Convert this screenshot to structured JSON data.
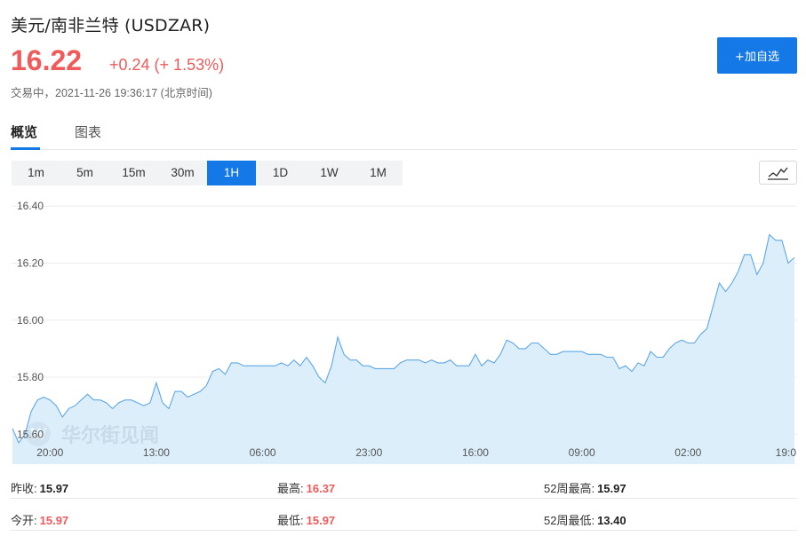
{
  "header": {
    "title": "美元/南非兰特 (USDZAR)",
    "price": "16.22",
    "change": "+0.24 (+ 1.53%)",
    "status": "交易中，2021-11-26 19:36:17 (北京时间)",
    "add_button": "+加自选"
  },
  "tabs": [
    {
      "label": "概览",
      "active": true
    },
    {
      "label": "图表",
      "active": false
    }
  ],
  "periods": [
    {
      "label": "1m",
      "active": false
    },
    {
      "label": "5m",
      "active": false
    },
    {
      "label": "15m",
      "active": false
    },
    {
      "label": "30m",
      "active": false
    },
    {
      "label": "1H",
      "active": true
    },
    {
      "label": "1D",
      "active": false
    },
    {
      "label": "1W",
      "active": false
    },
    {
      "label": "1M",
      "active": false
    }
  ],
  "chart_type_icon": "line-chart-icon",
  "watermark": "华尔街见闻",
  "colors": {
    "accent": "#1478e6",
    "up": "#f05a5a",
    "line": "#5ea8e6",
    "fill": "#ddeefb"
  },
  "chart_data": {
    "type": "area",
    "ytick_labels": [
      "16.40",
      "16.20",
      "16.00",
      "15.80",
      "15.60"
    ],
    "yticks": [
      16.4,
      16.2,
      16.0,
      15.8,
      15.6
    ],
    "ylim": [
      15.495,
      16.435
    ],
    "xtick_labels": [
      "20:00",
      "13:00",
      "06:00",
      "23:00",
      "16:00",
      "09:00",
      "02:00",
      "19:0"
    ],
    "xtick_index": [
      6,
      23,
      40,
      57,
      74,
      91,
      108,
      125
    ],
    "values": [
      15.62,
      15.57,
      15.6,
      15.68,
      15.72,
      15.73,
      15.72,
      15.7,
      15.66,
      15.69,
      15.7,
      15.72,
      15.74,
      15.72,
      15.72,
      15.71,
      15.69,
      15.71,
      15.72,
      15.72,
      15.71,
      15.7,
      15.71,
      15.78,
      15.71,
      15.69,
      15.75,
      15.75,
      15.73,
      15.74,
      15.75,
      15.77,
      15.82,
      15.83,
      15.81,
      15.85,
      15.85,
      15.84,
      15.84,
      15.84,
      15.84,
      15.84,
      15.84,
      15.85,
      15.84,
      15.86,
      15.84,
      15.87,
      15.84,
      15.8,
      15.78,
      15.84,
      15.94,
      15.88,
      15.86,
      15.86,
      15.84,
      15.84,
      15.83,
      15.83,
      15.83,
      15.83,
      15.85,
      15.86,
      15.86,
      15.86,
      15.85,
      15.86,
      15.85,
      15.85,
      15.86,
      15.84,
      15.84,
      15.84,
      15.88,
      15.84,
      15.86,
      15.85,
      15.88,
      15.93,
      15.92,
      15.9,
      15.9,
      15.92,
      15.92,
      15.9,
      15.88,
      15.88,
      15.89,
      15.89,
      15.89,
      15.89,
      15.88,
      15.88,
      15.88,
      15.87,
      15.87,
      15.83,
      15.84,
      15.82,
      15.85,
      15.84,
      15.89,
      15.87,
      15.87,
      15.9,
      15.92,
      15.93,
      15.92,
      15.92,
      15.95,
      15.97,
      16.05,
      16.13,
      16.1,
      16.13,
      16.17,
      16.23,
      16.23,
      16.16,
      16.2,
      16.3,
      16.28,
      16.28,
      16.2,
      16.22
    ],
    "grid": true
  },
  "stats": {
    "prev_close_label": "昨收:",
    "prev_close": "15.97",
    "high_label": "最高:",
    "high": "16.37",
    "high52_label": "52周最高:",
    "high52": "15.97",
    "open_label": "今开:",
    "open": "15.97",
    "low_label": "最低:",
    "low": "15.97",
    "low52_label": "52周最低:",
    "low52": "13.40"
  }
}
